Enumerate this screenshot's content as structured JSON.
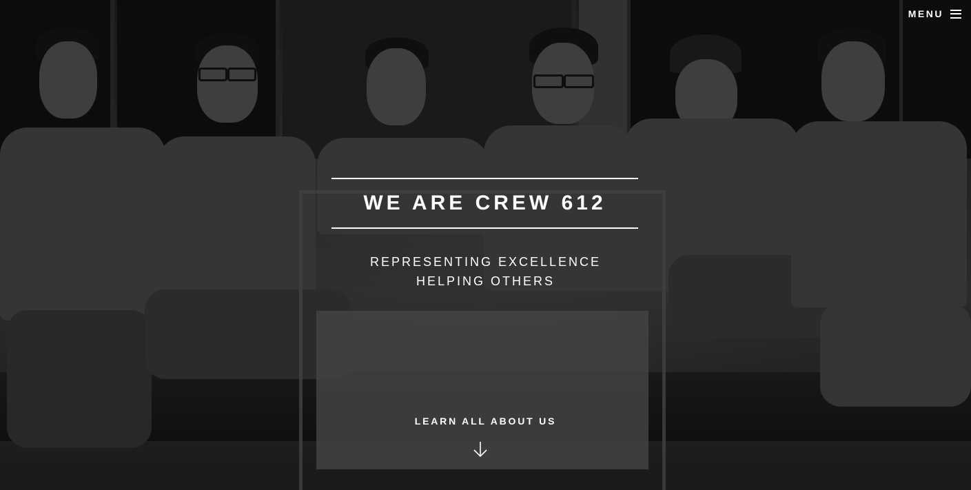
{
  "nav": {
    "menu_label": "MENU",
    "menu_icon": "hamburger-icon"
  },
  "hero": {
    "title": "WE ARE CREW 612",
    "subtitle_lines": [
      "REPRESENTING EXCELLENCE",
      "HELPING OTHERS"
    ],
    "cta_label": "LEARN ALL ABOUT US",
    "cta_icon": "arrow-down-icon"
  },
  "colors": {
    "text": "#ffffff",
    "overlay": "#000000"
  }
}
